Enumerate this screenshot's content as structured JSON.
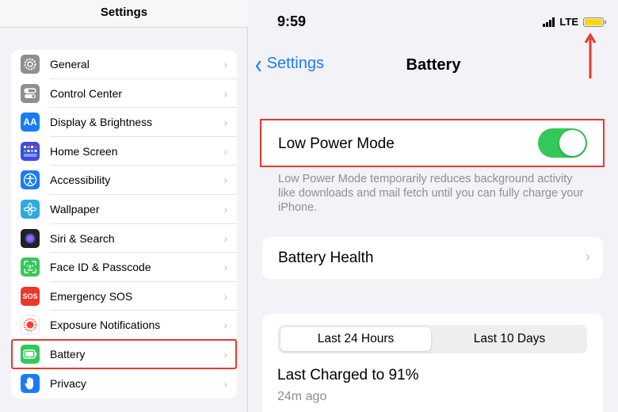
{
  "left": {
    "title": "Settings",
    "items": [
      {
        "label": "General",
        "icon": "gear-icon",
        "color": "#8e8e93"
      },
      {
        "label": "Control Center",
        "icon": "toggles-icon",
        "color": "#8e8e93"
      },
      {
        "label": "Display & Brightness",
        "icon": "text-size-icon",
        "glyph": "AA",
        "color": "#1a7cf5"
      },
      {
        "label": "Home Screen",
        "icon": "app-grid-icon",
        "color": "#3b4de0"
      },
      {
        "label": "Accessibility",
        "icon": "accessibility-icon",
        "color": "#1a7cf5"
      },
      {
        "label": "Wallpaper",
        "icon": "flower-icon",
        "color": "#32a8e0"
      },
      {
        "label": "Siri & Search",
        "icon": "siri-icon",
        "color": "#222222"
      },
      {
        "label": "Face ID & Passcode",
        "icon": "face-id-icon",
        "color": "#34c759"
      },
      {
        "label": "Emergency SOS",
        "icon": "sos-icon",
        "glyph": "SOS",
        "color": "#e8392b"
      },
      {
        "label": "Exposure Notifications",
        "icon": "exposure-icon",
        "color": "#ffffff"
      },
      {
        "label": "Battery",
        "icon": "battery-icon",
        "color": "#34c759"
      },
      {
        "label": "Privacy",
        "icon": "hand-icon",
        "color": "#1a7cf5"
      }
    ]
  },
  "status": {
    "time": "9:59",
    "network": "LTE",
    "battery_color": "#ffd60a"
  },
  "nav": {
    "back_label": "Settings",
    "title": "Battery"
  },
  "low_power": {
    "label": "Low Power Mode",
    "on": true,
    "description": "Low Power Mode temporarily reduces background activity like downloads and mail fetch until you can fully charge your iPhone."
  },
  "health": {
    "label": "Battery Health"
  },
  "stats": {
    "tabs": [
      "Last 24 Hours",
      "Last 10 Days"
    ],
    "selected_tab": "Last 24 Hours",
    "last_charged": "Last Charged to 91%",
    "ago": "24m ago"
  },
  "colors": {
    "accent": "#1a7cf5",
    "toggle_on": "#34c759",
    "highlight": "#e8392b"
  }
}
